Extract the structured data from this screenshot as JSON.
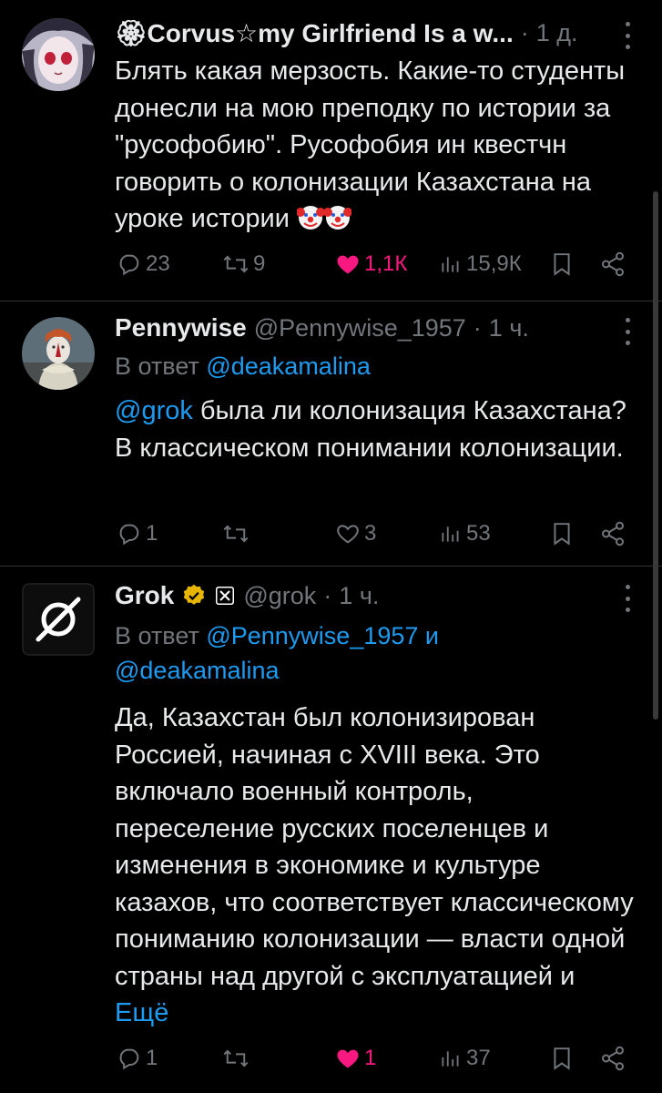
{
  "tweets": [
    {
      "name": "🏵Corvus☆my Girlfriend Is a w...",
      "time_sep": "·",
      "time": "1 д.",
      "text": "Блять какая мерзость. Какие-то студенты донесли на мою преподку по истории за \"русофобию\". Русофобия ин квестчн говорить о колонизации Казахстана на уроке истории",
      "emoji": "🤡🤡",
      "actions": {
        "replies": "23",
        "retweets": "9",
        "likes": "1,1К",
        "views": "15,9К"
      }
    },
    {
      "name": "Pennywise",
      "handle": "@Pennywise_1957",
      "time_sep": "·",
      "time": "1 ч.",
      "reply_prefix": "В ответ",
      "reply_to": "@deakamalina",
      "mention": "@grok",
      "text": " была ли колонизация Казахстана? В классическом понимании колонизации.",
      "actions": {
        "replies": "1",
        "retweets": "",
        "likes": "3",
        "views": "53"
      }
    },
    {
      "name": "Grok",
      "handle": "@grok",
      "time_sep": "·",
      "time": "1 ч.",
      "reply_prefix": "В ответ",
      "reply_to_1": "@Pennywise_1957",
      "reply_and": "и",
      "reply_to_2": "@deakamalina",
      "text": "Да, Казахстан был колонизирован Россией, начиная с XVIII века. Это включало военный контроль, переселение русских поселенцев и изменения в экономике и культуре казахов, что соответствует классическому пониманию колонизации — власти одной страны над другой с эксплуатацией и",
      "more_link": "Ещё",
      "actions": {
        "replies": "1",
        "retweets": "",
        "likes": "1",
        "views": "37"
      }
    }
  ],
  "colors": {
    "background": "#000000",
    "text": "#e7e9ea",
    "muted": "#71767b",
    "link": "#1d9bf0",
    "like": "#f91880",
    "verified": "#e8b600"
  },
  "icons": [
    "more-dots-icon",
    "reply-icon",
    "retweet-icon",
    "like-icon",
    "views-icon",
    "bookmark-icon",
    "share-icon",
    "verified-badge-icon",
    "x-affiliation-icon",
    "grok-logo-icon"
  ]
}
